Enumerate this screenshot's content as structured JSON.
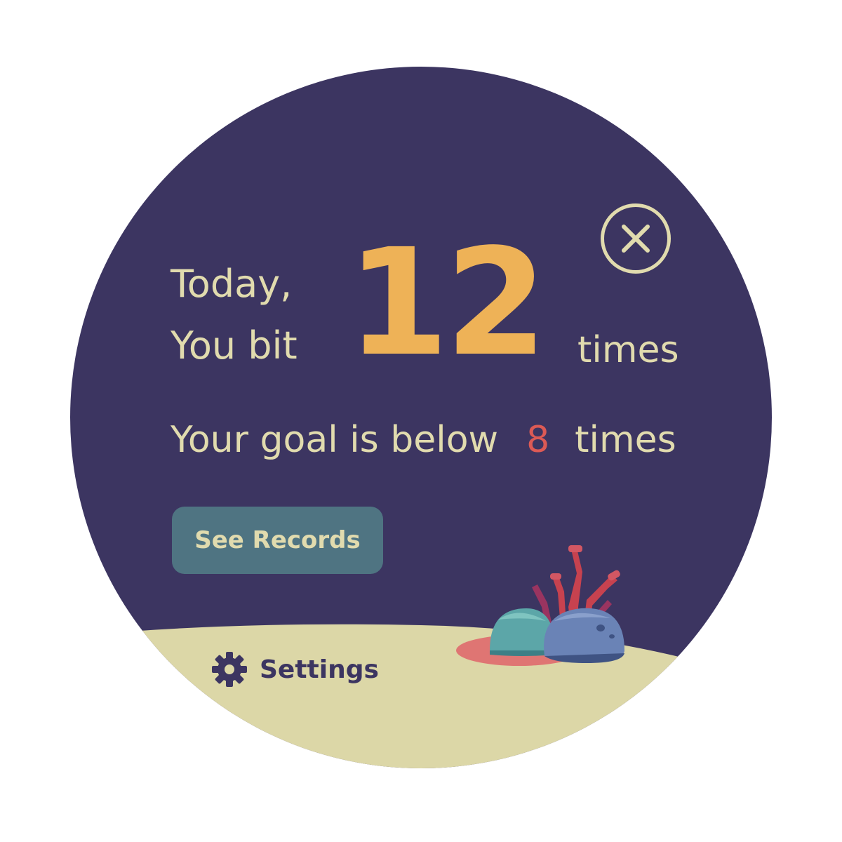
{
  "summary": {
    "line1": "Today,",
    "line2": "You bit",
    "count": "12",
    "unit": "times"
  },
  "goal": {
    "prefix": "Your goal is below",
    "value": "8",
    "suffix": "times"
  },
  "actions": {
    "see_records_label": "See Records",
    "settings_label": "Settings"
  },
  "icons": {
    "close": "close-icon",
    "settings": "gear-icon"
  },
  "colors": {
    "background": "#3c3561",
    "text": "#e1dbae",
    "count": "#eeb257",
    "goal_value": "#dc5a55",
    "button": "#4f7482",
    "sand": "#dcd7a7"
  }
}
